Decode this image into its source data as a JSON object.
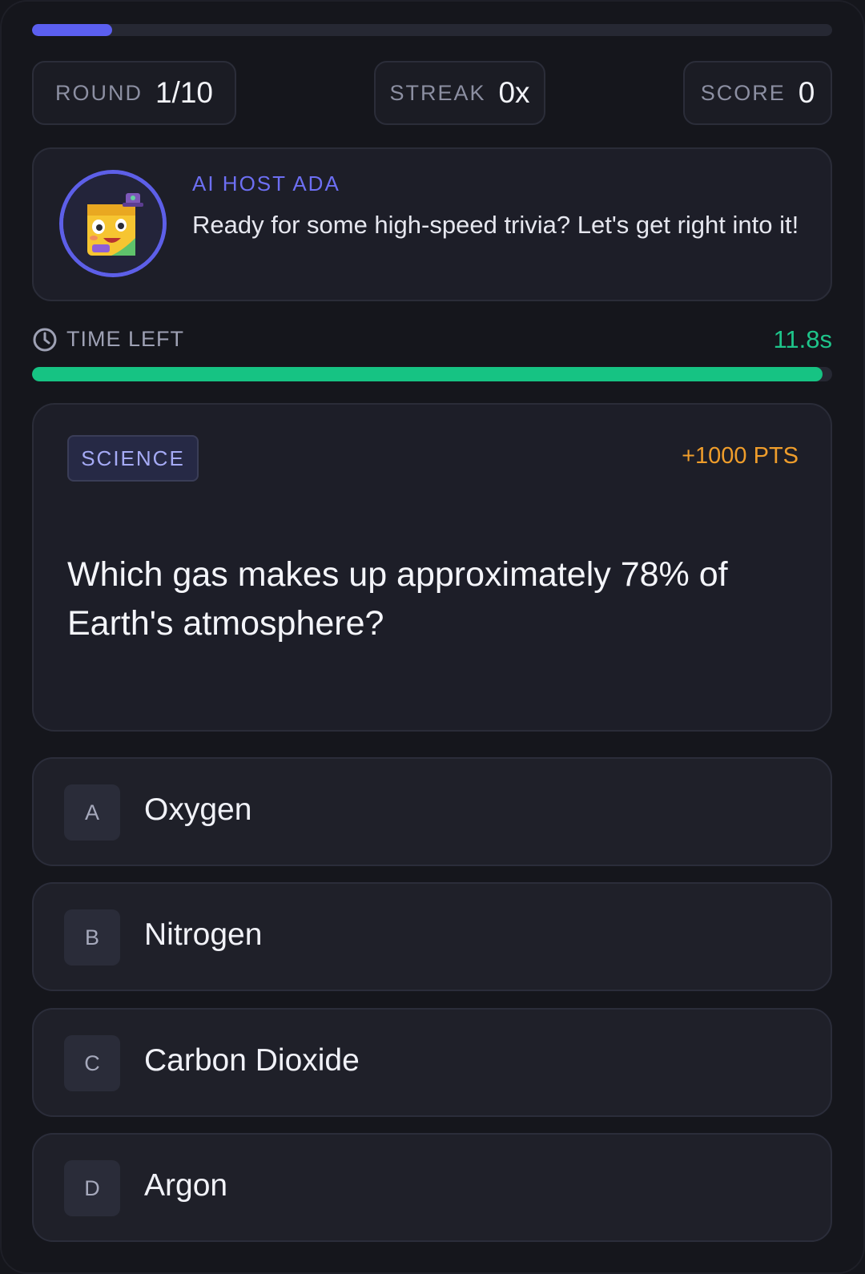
{
  "progress": {
    "fraction": 0.1
  },
  "stats": {
    "round": {
      "label": "ROUND",
      "value": "1/10"
    },
    "streak": {
      "label": "STREAK",
      "value": "0x"
    },
    "score": {
      "label": "SCORE",
      "value": "0"
    }
  },
  "host": {
    "name": "AI HOST ADA",
    "message": "Ready for some high-speed trivia? Let's get right into it!",
    "avatar_icon": "robot-mascot-icon"
  },
  "timer": {
    "label": "TIME LEFT",
    "value": "11.8s",
    "fraction": 0.988,
    "icon": "clock-icon"
  },
  "question": {
    "category": "SCIENCE",
    "points": "+1000 PTS",
    "text": "Which gas makes up approximately 78% of Earth's atmosphere?"
  },
  "answers": [
    {
      "letter": "A",
      "text": "Oxygen"
    },
    {
      "letter": "B",
      "text": "Nitrogen"
    },
    {
      "letter": "C",
      "text": "Carbon Dioxide"
    },
    {
      "letter": "D",
      "text": "Argon"
    }
  ],
  "colors": {
    "accent": "#5b5ff0",
    "timer": "#16c383",
    "points": "#ef9d2b",
    "background": "#15161c"
  }
}
